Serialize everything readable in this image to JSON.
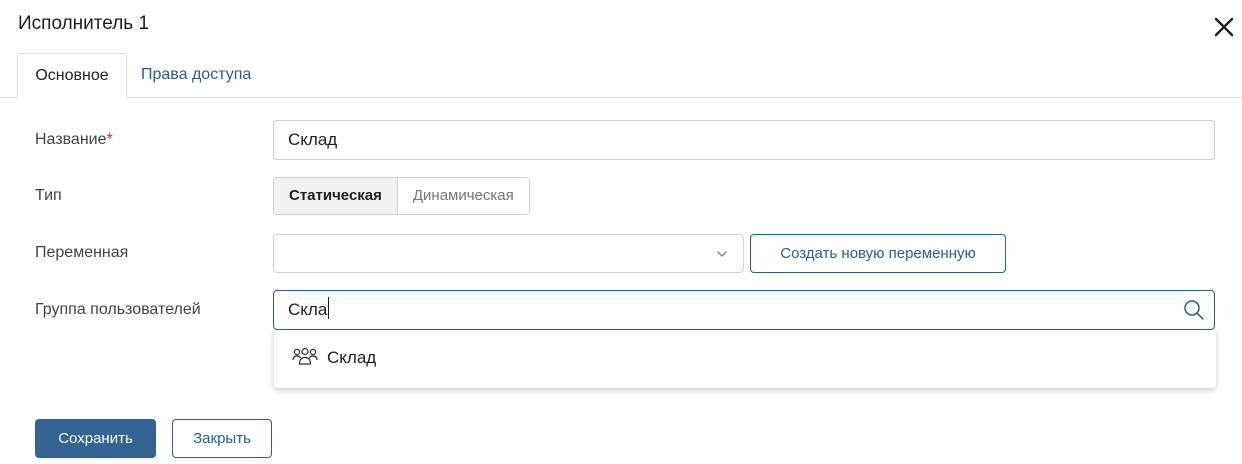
{
  "dialog": {
    "title": "Исполнитель 1",
    "close_icon": "close-icon"
  },
  "tabs": [
    {
      "label": "Основное",
      "active": true
    },
    {
      "label": "Права доступа",
      "active": false
    }
  ],
  "form": {
    "name": {
      "label": "Название",
      "required_mark": "*",
      "value": "Склад"
    },
    "type": {
      "label": "Тип",
      "options": [
        "Статическая",
        "Динамическая"
      ],
      "selected": "Статическая"
    },
    "variable": {
      "label": "Переменная",
      "value": "",
      "dropdown_icon": "chevron-down-icon",
      "create_button": "Создать новую переменную"
    },
    "user_group": {
      "label": "Группа пользователей",
      "value": "Скла",
      "search_icon": "search-icon"
    }
  },
  "suggestions": [
    {
      "icon": "user-group-icon",
      "label": "Склад"
    }
  ],
  "footer": {
    "save_label": "Сохранить",
    "close_label": "Закрыть"
  },
  "colors": {
    "accent": "#356393",
    "link": "#2a5f8f",
    "required": "#d0342c",
    "focus_border": "#2a5f8f"
  }
}
